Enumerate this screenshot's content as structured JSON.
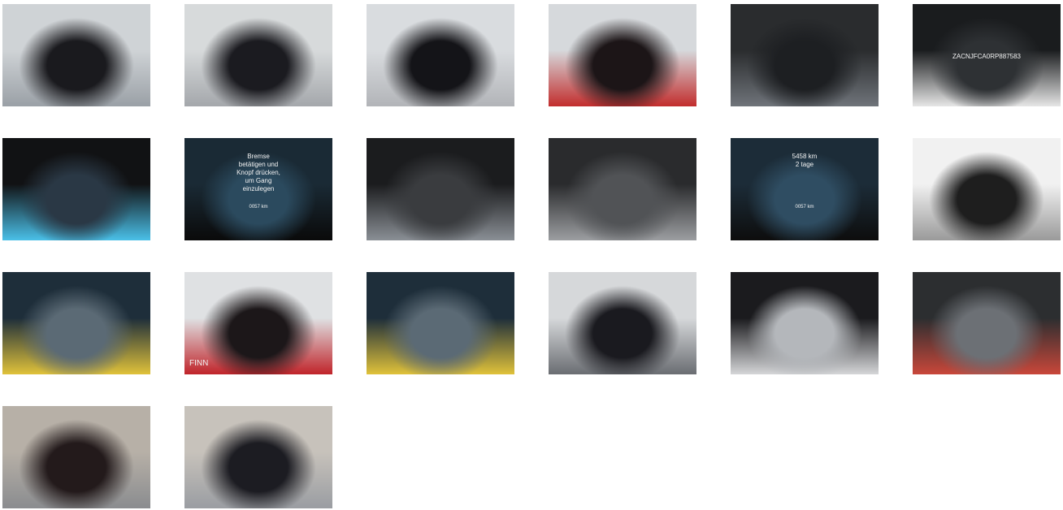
{
  "gallery": {
    "photos": [
      {
        "subject": "front-left exterior",
        "colors": [
          "#cfd3d6",
          "#1a1a1e",
          "#9aa0a6"
        ]
      },
      {
        "subject": "front-left exterior angle",
        "colors": [
          "#d7dadb",
          "#1b1b20",
          "#a4a7ab"
        ]
      },
      {
        "subject": "rear-left exterior",
        "colors": [
          "#d9dcdf",
          "#141418",
          "#b2b4b8"
        ]
      },
      {
        "subject": "rear-right exterior",
        "colors": [
          "#d6d9dc",
          "#1c1517",
          "#c22d2d"
        ]
      },
      {
        "subject": "interior dashboard",
        "colors": [
          "#2a2c2e",
          "#1d1f22",
          "#6f747a"
        ]
      },
      {
        "subject": "VIN plate",
        "colors": [
          "#1a1c1e",
          "#2e3134",
          "#e6e6e6"
        ],
        "text": "ZACNJFCA0RP887583"
      },
      {
        "subject": "instrument cluster",
        "colors": [
          "#111214",
          "#2a3845",
          "#4ac0e8"
        ]
      },
      {
        "subject": "cluster message",
        "colors": [
          "#1a2a35",
          "#2b4a5e",
          "#0a0a0a"
        ],
        "text": "Bremse\nbetätigen und\nKnopf drücken,\num Gang\neinzulegen",
        "footer": "0057 km"
      },
      {
        "subject": "center console",
        "colors": [
          "#1b1c1e",
          "#3a3c3f",
          "#8a8f95"
        ]
      },
      {
        "subject": "seat fabric",
        "colors": [
          "#2a2b2d",
          "#515356",
          "#9c9ea1"
        ]
      },
      {
        "subject": "cluster odometer",
        "colors": [
          "#1c2c38",
          "#2f4d62",
          "#0d0d0d"
        ],
        "text": "5458 km\n2 tage",
        "footer": "0057 km"
      },
      {
        "subject": "service document",
        "colors": [
          "#f1f1f1",
          "#1e1e1e",
          "#9a9a9a"
        ]
      },
      {
        "subject": "spare wheel well",
        "colors": [
          "#1e2e3a",
          "#5b6a75",
          "#e0c23a"
        ]
      },
      {
        "subject": "roof rear view",
        "colors": [
          "#dfe1e3",
          "#1c1719",
          "#c0242a"
        ],
        "text": "FINN"
      },
      {
        "subject": "spare wheel well",
        "colors": [
          "#1e2e3a",
          "#5b6a75",
          "#e0c23a"
        ]
      },
      {
        "subject": "open trunk",
        "colors": [
          "#d6d8da",
          "#1a1a1f",
          "#6a6d72"
        ]
      },
      {
        "subject": "alloy wheel",
        "colors": [
          "#1b1b1e",
          "#b4b7bb",
          "#d5d6d8"
        ]
      },
      {
        "subject": "engine bay",
        "colors": [
          "#2c2e30",
          "#6c7075",
          "#c9473a"
        ]
      },
      {
        "subject": "windshield front",
        "colors": [
          "#b7b0a7",
          "#231a1b",
          "#8a8c8f"
        ]
      },
      {
        "subject": "windshield front",
        "colors": [
          "#c7c2bb",
          "#1c1c22",
          "#9a9da2"
        ]
      }
    ]
  }
}
